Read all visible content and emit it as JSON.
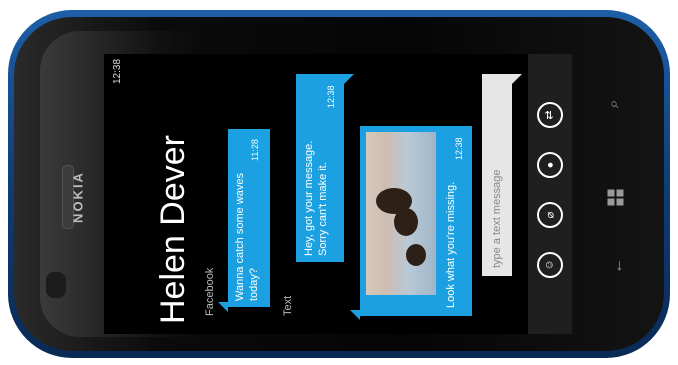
{
  "device": {
    "brand": "NOKIA"
  },
  "status_bar": {
    "time": "12:38"
  },
  "conversation": {
    "contact_name": "Helen Dever",
    "messages": [
      {
        "channel": "Facebook",
        "lines": [
          "Wanna catch some waves",
          "today?"
        ],
        "time": "11:28",
        "direction": "received"
      },
      {
        "channel": "Text",
        "lines": [
          "Hey, got your message.",
          "Sorry can't make it."
        ],
        "time": "12:38",
        "direction": "sent"
      },
      {
        "channel": "",
        "lines": [
          "Look what you're missing."
        ],
        "time": "12:38",
        "direction": "received",
        "has_photo": true
      }
    ]
  },
  "composer": {
    "placeholder": "type a text message"
  },
  "app_bar": {
    "buttons": [
      {
        "icon": "switch-icon"
      },
      {
        "icon": "microphone-icon"
      },
      {
        "icon": "attach-icon"
      },
      {
        "icon": "smiley-icon"
      }
    ]
  },
  "hardware_keys": {
    "back": "back-arrow-icon",
    "start": "windows-logo-icon",
    "search": "search-icon"
  },
  "colors": {
    "accent": "#1ba1e2",
    "phone_body": "#1d5fa8",
    "screen": "#000000"
  }
}
